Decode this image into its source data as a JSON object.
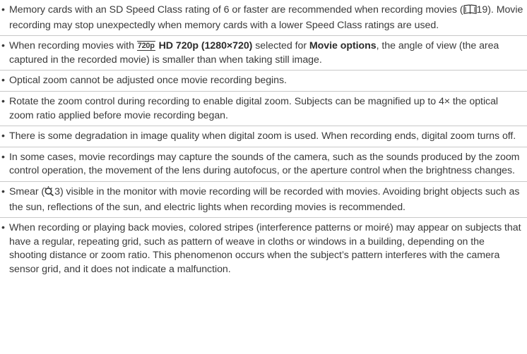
{
  "bullets": [
    {
      "text": "Memory cards with an SD Speed Class rating of 6 or faster are recommended when recording movies (",
      "ref_page": "19",
      "text_after": "). Movie recording may stop unexpectedly when memory cards with a lower Speed Class ratings are used."
    },
    {
      "text_before": "When recording movies with ",
      "icon_label": "720p",
      "bold_option": "HD 720p (1280×720)",
      "text_middle": " selected for ",
      "bold_menu": "Movie options",
      "text_after": ", the angle of view (the area captured in the recorded movie) is smaller than when taking still image."
    },
    {
      "text": "Optical zoom cannot be adjusted once movie recording begins."
    },
    {
      "text": "Rotate the zoom control during recording to enable digital zoom. Subjects can be magnified up to 4× the optical zoom ratio applied before movie recording began."
    },
    {
      "text": "There is some degradation in image quality when digital zoom is used. When recording ends, digital zoom turns off."
    },
    {
      "text": "In some cases, movie recordings may capture the sounds of the camera, such as the sounds produced by the zoom control operation, the movement of the lens during autofocus, or the aperture control when the brightness changes."
    },
    {
      "text_before": "Smear (",
      "ref_page": "3",
      "text_after": ") visible in the monitor with movie recording will be recorded with movies. Avoiding bright objects such as the sun, reflections of the sun, and electric lights when recording movies is recommended."
    },
    {
      "text": "When recording or playing back movies, colored stripes (interference patterns or moiré) may appear on subjects that have a regular, repeating grid, such as pattern of weave in cloths or windows in a building, depending on the shooting distance or zoom ratio. This phenomenon occurs when the subject’s pattern interferes with the camera sensor grid, and it does not indicate a malfunction."
    }
  ],
  "icons": {
    "book_ref": "book-reference-icon",
    "tip_ref": "tips-reference-icon",
    "hd_movie": "hd-720p-movie-icon"
  }
}
